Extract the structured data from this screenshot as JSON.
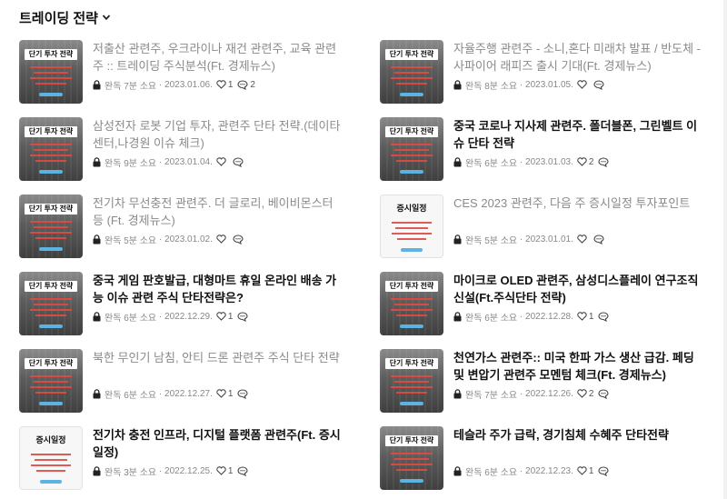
{
  "header": {
    "title": "트레이딩 전략"
  },
  "posts": [
    {
      "title": "저출산 관련주, 우크라이나 재건 관련주, 교육 관련주 :: 트레이딩 주식분석(Ft. 경제뉴스)",
      "status": "완독",
      "read_time": "7분 소요",
      "date": "2023.01.06.",
      "likes": "1",
      "comments": "2",
      "thumb_text": "단기 투자 전략",
      "thumb_style": "dark",
      "read": true
    },
    {
      "title": "자율주행 관련주 - 소니,혼다 미래차 발표 / 반도체 - 사파이어 래피즈 출시 기대(Ft. 경제뉴스)",
      "status": "완독",
      "read_time": "8분 소요",
      "date": "2023.01.05.",
      "likes": "",
      "comments": "",
      "thumb_text": "단기 투자 전략",
      "thumb_style": "dark",
      "read": true
    },
    {
      "title": "삼성전자 로봇 기업 투자, 관련주 단타 전략.(데이타센터,나경원 이슈 체크)",
      "status": "완독",
      "read_time": "9분 소요",
      "date": "2023.01.04.",
      "likes": "",
      "comments": "",
      "thumb_text": "단기 투자 전략",
      "thumb_style": "dark",
      "read": true
    },
    {
      "title": "중국 코로나 지사제 관련주. 폴더블폰, 그린벨트 이슈 단타 전략",
      "status": "완독",
      "read_time": "6분 소요",
      "date": "2023.01.03.",
      "likes": "2",
      "comments": "",
      "thumb_text": "단기 투자 전략",
      "thumb_style": "dark",
      "read": false
    },
    {
      "title": "전기차 무선충전 관련주. 더 글로리, 베이비몬스터 등 (Ft. 경제뉴스)",
      "status": "완독",
      "read_time": "5분 소요",
      "date": "2023.01.02.",
      "likes": "",
      "comments": "",
      "thumb_text": "단기 투자 전략",
      "thumb_style": "dark",
      "read": true
    },
    {
      "title": "CES 2023 관련주, 다음 주 증시일정 투자포인트",
      "status": "완독",
      "read_time": "5분 소요",
      "date": "2023.01.01.",
      "likes": "",
      "comments": "",
      "thumb_text": "증시일정",
      "thumb_style": "light",
      "read": true
    },
    {
      "title": "중국 게임 판호발급, 대형마트 휴일 온라인 배송 가능 이슈 관련 주식 단타전략은?",
      "status": "완독",
      "read_time": "6분 소요",
      "date": "2022.12.29.",
      "likes": "1",
      "comments": "",
      "thumb_text": "단기 투자 전략",
      "thumb_style": "dark",
      "read": false
    },
    {
      "title": "마이크로 OLED 관련주, 삼성디스플레이 연구조직 신설(Ft.주식단타 전략)",
      "status": "완독",
      "read_time": "6분 소요",
      "date": "2022.12.28.",
      "likes": "1",
      "comments": "",
      "thumb_text": "단기 투자 전략",
      "thumb_style": "dark",
      "read": false
    },
    {
      "title": "북한 무인기 남침, 안티 드론 관련주 주식 단타 전략",
      "status": "완독",
      "read_time": "6분 소요",
      "date": "2022.12.27.",
      "likes": "1",
      "comments": "",
      "thumb_text": "단기 투자 전략",
      "thumb_style": "dark",
      "read": true
    },
    {
      "title": "천연가스 관련주:: 미국 한파 가스 생산 급감. 페딩 및 변압기 관련주 모멘텀 체크(Ft. 경제뉴스)",
      "status": "완독",
      "read_time": "7분 소요",
      "date": "2022.12.26.",
      "likes": "2",
      "comments": "",
      "thumb_text": "단기 투자 전략",
      "thumb_style": "dark",
      "read": false
    },
    {
      "title": "전기차 충전 인프라, 디지털 플랫폼 관련주(Ft. 증시일정)",
      "status": "완독",
      "read_time": "3분 소요",
      "date": "2022.12.25.",
      "likes": "1",
      "comments": "",
      "thumb_text": "증시일정",
      "thumb_style": "light",
      "read": false
    },
    {
      "title": "테슬라 주가 급락, 경기침체 수혜주 단타전략",
      "status": "완독",
      "read_time": "6분 소요",
      "date": "2022.12.23.",
      "likes": "1",
      "comments": "",
      "thumb_text": "단기 투자 전략",
      "thumb_style": "dark",
      "read": false
    }
  ]
}
